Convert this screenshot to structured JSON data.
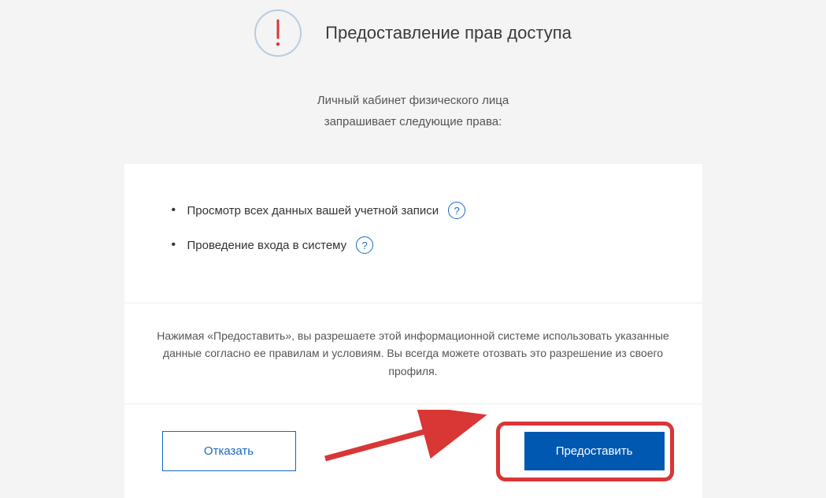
{
  "header": {
    "title": "Предоставление прав доступа"
  },
  "subtitle": {
    "line1": "Личный кабинет физического лица",
    "line2": "запрашивает следующие права:"
  },
  "permissions": {
    "items": [
      {
        "label": "Просмотр всех данных вашей учетной записи"
      },
      {
        "label": "Проведение входа в систему"
      }
    ],
    "help_symbol": "?"
  },
  "disclaimer": {
    "text": "Нажимая «Предоставить», вы разрешаете этой информационной системе использовать указанные данные согласно ее правилам и условиям. Вы всегда можете отозвать это разрешение из своего профиля."
  },
  "buttons": {
    "decline_label": "Отказать",
    "accept_label": "Предоставить"
  }
}
